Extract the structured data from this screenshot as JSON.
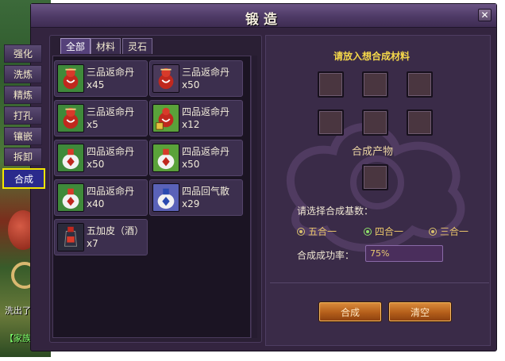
{
  "window": {
    "title": "锻造",
    "close_glyph": "✕"
  },
  "side_tabs": [
    {
      "label": "强化"
    },
    {
      "label": "洗炼"
    },
    {
      "label": "精炼"
    },
    {
      "label": "打孔"
    },
    {
      "label": "镶嵌"
    },
    {
      "label": "拆卸"
    },
    {
      "label": "合成"
    }
  ],
  "world_texts": [
    "洗出了你",
    "【家族】"
  ],
  "category_tabs": [
    {
      "label": "全部"
    },
    {
      "label": "材料"
    },
    {
      "label": "灵石"
    }
  ],
  "items": [
    {
      "name": "三品返命丹",
      "qty": "x45",
      "icon": "red-gourd-icon"
    },
    {
      "name": "三品返命丹",
      "qty": "x50",
      "icon": "red-gourd-icon"
    },
    {
      "name": "三品返命丹",
      "qty": "x5",
      "icon": "red-gourd-icon"
    },
    {
      "name": "四品返命丹",
      "qty": "x12",
      "icon": "red-gourd-locked-icon"
    },
    {
      "name": "四品返命丹",
      "qty": "x50",
      "icon": "white-red-bottle-icon"
    },
    {
      "name": "四品返命丹",
      "qty": "x50",
      "icon": "white-red-bottle-icon"
    },
    {
      "name": "四品返命丹",
      "qty": "x40",
      "icon": "white-red-bottle-icon"
    },
    {
      "name": "四品回气散",
      "qty": "x29",
      "icon": "white-blue-bottle-icon"
    },
    {
      "name": "五加皮（酒）",
      "qty": "x7",
      "icon": "wine-jar-icon"
    }
  ],
  "craft": {
    "heading": "请放入想合成材料",
    "product_label": "合成产物",
    "base_label": "请选择合成基数：",
    "options": [
      {
        "label": "五合一",
        "selected": false
      },
      {
        "label": "四合一",
        "selected": true
      },
      {
        "label": "三合一",
        "selected": false
      }
    ],
    "rate_label": "合成成功率：",
    "rate_value": "75%",
    "buttons": {
      "compose": "合成",
      "clear": "清空"
    }
  },
  "colors": {
    "accent_yellow": "#f5d84a",
    "button_orange": "#b45e1a",
    "selected_green": "#8ee06a",
    "active_tab_highlight": "#f2e600"
  }
}
